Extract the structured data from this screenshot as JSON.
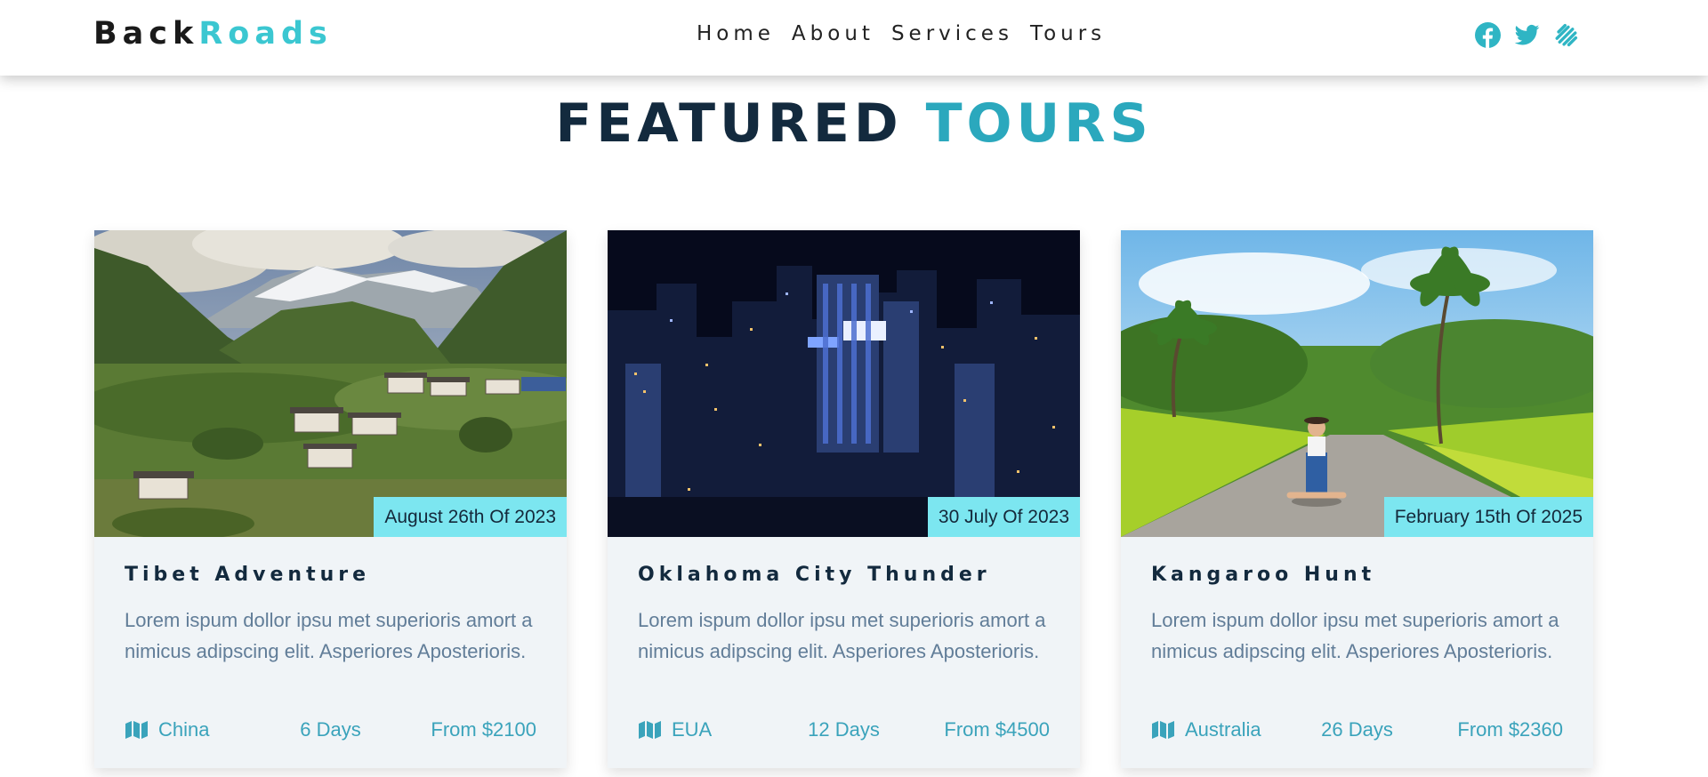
{
  "brand": {
    "part1": "Back",
    "part2": "Roads"
  },
  "nav": {
    "items": [
      "Home",
      "About",
      "Services",
      "Tours"
    ]
  },
  "social": [
    "facebook-icon",
    "twitter-icon",
    "squarespace-icon"
  ],
  "section": {
    "title_dark": "FEATURED",
    "title_accent": "TOURS"
  },
  "colors": {
    "accent": "#3bc7d1",
    "dark": "#132a3e",
    "date_badge": "#7ce6f0",
    "card_bg": "#f0f4f7",
    "text_muted": "#617d98"
  },
  "tours": [
    {
      "image": "mountain-village-photo",
      "date": "August 26th Of 2023",
      "title": "Tibet Adventure",
      "description": "Lorem ispum dollor ipsu met superioris amort a nimicus adipscing elit. Asperiores Aposterioris.",
      "location": "China",
      "duration": "6 Days",
      "price": "From $2100"
    },
    {
      "image": "night-city-skyline-photo",
      "date": "30 July Of 2023",
      "title": "Oklahoma City Thunder",
      "description": "Lorem ispum dollor ipsu met superioris amort a nimicus adipscing elit. Asperiores Aposterioris.",
      "location": "EUA",
      "duration": "12 Days",
      "price": "From $4500"
    },
    {
      "image": "tropical-road-photo",
      "date": "February 15th Of 2025",
      "title": "Kangaroo Hunt",
      "description": "Lorem ispum dollor ipsu met superioris amort a nimicus adipscing elit. Asperiores Aposterioris.",
      "location": "Australia",
      "duration": "26 Days",
      "price": "From $2360"
    }
  ]
}
